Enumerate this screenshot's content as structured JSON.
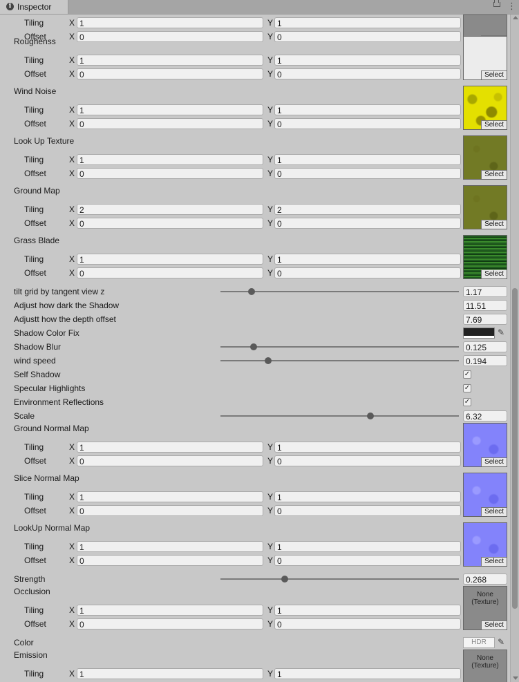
{
  "window": {
    "tab_title": "Inspector",
    "info_glyph": "i",
    "menu_glyph": "⋮"
  },
  "textures": [
    {
      "name": "",
      "tiling": [
        "1",
        "1"
      ],
      "offset": [
        "0",
        "0"
      ],
      "select": "Select",
      "preview": "gray-partial"
    },
    {
      "name": "Roughenss",
      "tiling": [
        "1",
        "1"
      ],
      "offset": [
        "0",
        "0"
      ],
      "select": "Select",
      "preview": "blank"
    },
    {
      "name": "Wind Noise",
      "tiling": [
        "1",
        "1"
      ],
      "offset": [
        "0",
        "0"
      ],
      "select": "Select",
      "preview": "yellow"
    },
    {
      "name": "Look Up Texture",
      "tiling": [
        "1",
        "1"
      ],
      "offset": [
        "0",
        "0"
      ],
      "select": "Select",
      "preview": "olive"
    },
    {
      "name": "Ground Map",
      "tiling": [
        "2",
        "2"
      ],
      "offset": [
        "0",
        "0"
      ],
      "select": "Select",
      "preview": "olive"
    },
    {
      "name": "Grass Blade",
      "tiling": [
        "1",
        "1"
      ],
      "offset": [
        "0",
        "0"
      ],
      "select": "Select",
      "preview": "grass"
    },
    {
      "name": "Ground Normal Map",
      "tiling": [
        "1",
        "1"
      ],
      "offset": [
        "0",
        "0"
      ],
      "select": "Select",
      "preview": "normal"
    },
    {
      "name": "Slice Normal Map",
      "tiling": [
        "1",
        "1"
      ],
      "offset": [
        "0",
        "0"
      ],
      "select": "Select",
      "preview": "normal"
    },
    {
      "name": "LookUp Normal Map",
      "tiling": [
        "1",
        "1"
      ],
      "offset": [
        "0",
        "0"
      ],
      "select": "Select",
      "preview": "normal"
    },
    {
      "name": "Occlusion",
      "tiling": [
        "1",
        "1"
      ],
      "offset": [
        "0",
        "0"
      ],
      "select": "Select",
      "preview": "gray",
      "none_text": "None\n(Texture)"
    },
    {
      "name": "Emission",
      "tiling": [
        "1",
        "1"
      ],
      "offset": [],
      "select": "",
      "preview": "gray",
      "none_text": "None\n(Texture)"
    }
  ],
  "labels": {
    "tiling": "Tiling",
    "offset": "Offset",
    "x": "X",
    "y": "Y"
  },
  "properties": {
    "tilt_grid": {
      "label": "tilt grid by tangent view z",
      "value": "1.17",
      "slider": 0.13
    },
    "shadow_dark": {
      "label": "Adjust how dark the Shadow",
      "value": "11.51"
    },
    "depth_offset": {
      "label": "Adjustt how the depth offset",
      "value": "7.69"
    },
    "shadow_color": {
      "label": "Shadow Color Fix"
    },
    "shadow_blur": {
      "label": "Shadow Blur",
      "value": "0.125",
      "slider": 0.14
    },
    "wind_speed": {
      "label": "wind speed",
      "value": "0.194",
      "slider": 0.2
    },
    "self_shadow": {
      "label": "Self Shadow",
      "checked": "✓"
    },
    "specular": {
      "label": "Specular Highlights",
      "checked": "✓"
    },
    "env_reflections": {
      "label": "Environment Reflections",
      "checked": "✓"
    },
    "scale": {
      "label": "Scale",
      "value": "6.32",
      "slider": 0.63
    },
    "strength": {
      "label": "Strength",
      "value": "0.268",
      "slider": 0.27
    },
    "color": {
      "label": "Color",
      "hdr": "HDR"
    }
  }
}
